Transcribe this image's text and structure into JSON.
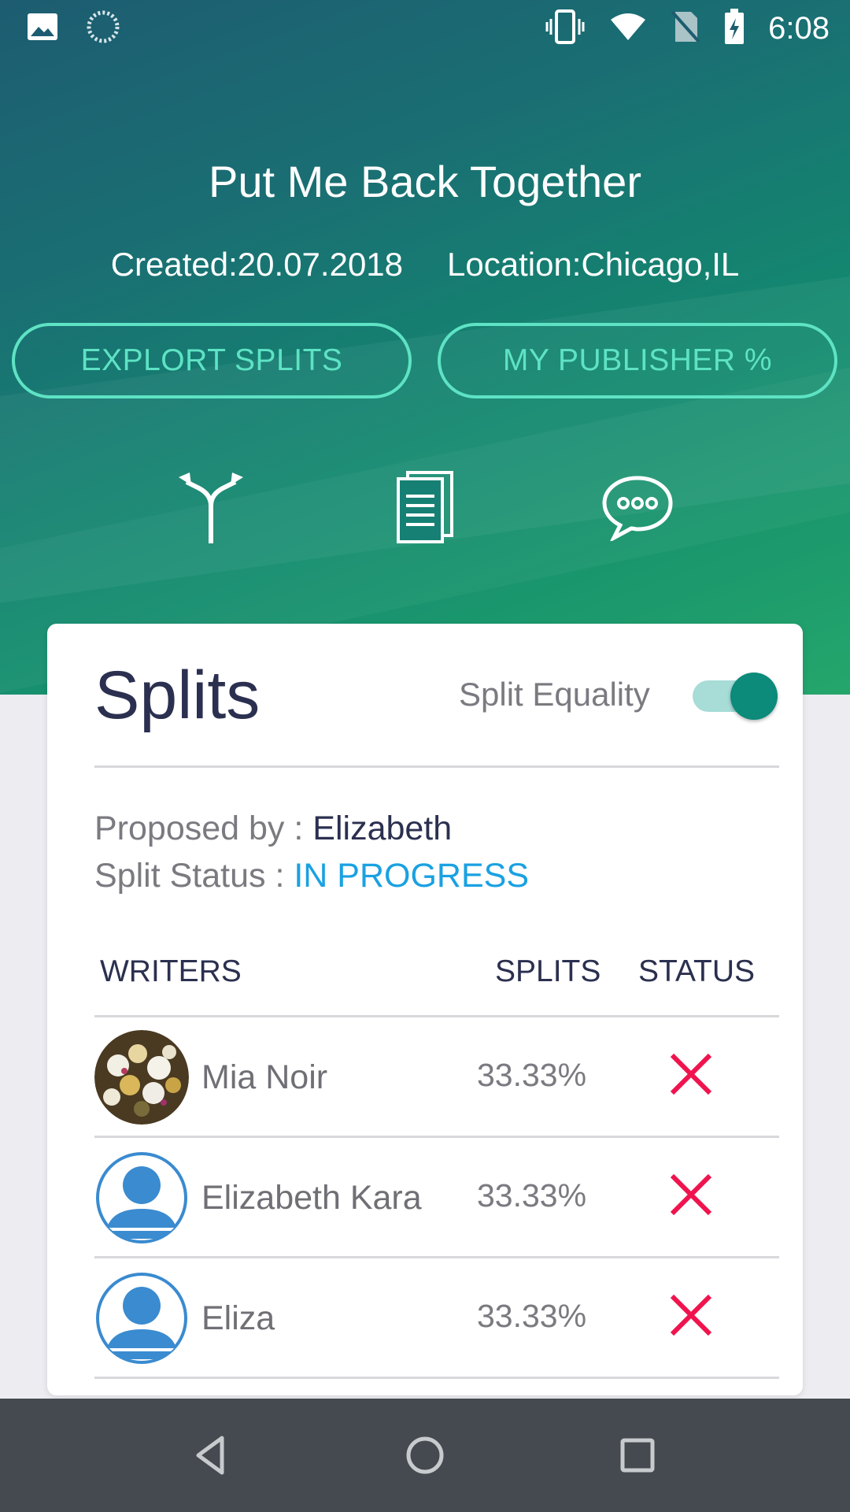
{
  "status_bar": {
    "time": "6:08",
    "icons_left": [
      "image-icon",
      "sync-spinner-icon"
    ],
    "icons_right": [
      "vibrate-icon",
      "wifi-icon",
      "no-sim-icon",
      "battery-charging-icon"
    ]
  },
  "song": {
    "title": "Put Me Back Together",
    "created": "Created:20.07.2018",
    "location": "Location:Chicago,IL"
  },
  "buttons": {
    "explort_splits": "EXPLORT SPLITS",
    "my_publisher": "MY PUBLISHER %"
  },
  "action_icons": [
    "split-arrows-icon",
    "documents-icon",
    "chat-bubble-icon"
  ],
  "splits_card": {
    "title": "Splits",
    "split_equality_label": "Split Equality",
    "split_equality_on": true,
    "proposed_by_label": "Proposed by : ",
    "proposed_by": "Elizabeth",
    "split_status_label": "Split Status : ",
    "split_status": "IN PROGRESS",
    "columns": [
      "WRITERS",
      "SPLITS",
      "STATUS"
    ],
    "writers": [
      {
        "name": "Mia Noir",
        "split": "33.33%",
        "status": "rejected",
        "avatar": "photo"
      },
      {
        "name": "Elizabeth Kara",
        "split": "33.33%",
        "status": "rejected",
        "avatar": "default"
      },
      {
        "name": "Eliza",
        "split": "33.33%",
        "status": "rejected",
        "avatar": "default"
      }
    ]
  },
  "colors": {
    "accent_teal": "#5ee3c4",
    "title_dark": "#2b3050",
    "status_blue": "#1aa1e2",
    "reject_red": "#f0144e",
    "toggle_thumb": "#0c8a7a"
  },
  "nav": [
    "back-icon",
    "home-icon",
    "recents-icon"
  ]
}
